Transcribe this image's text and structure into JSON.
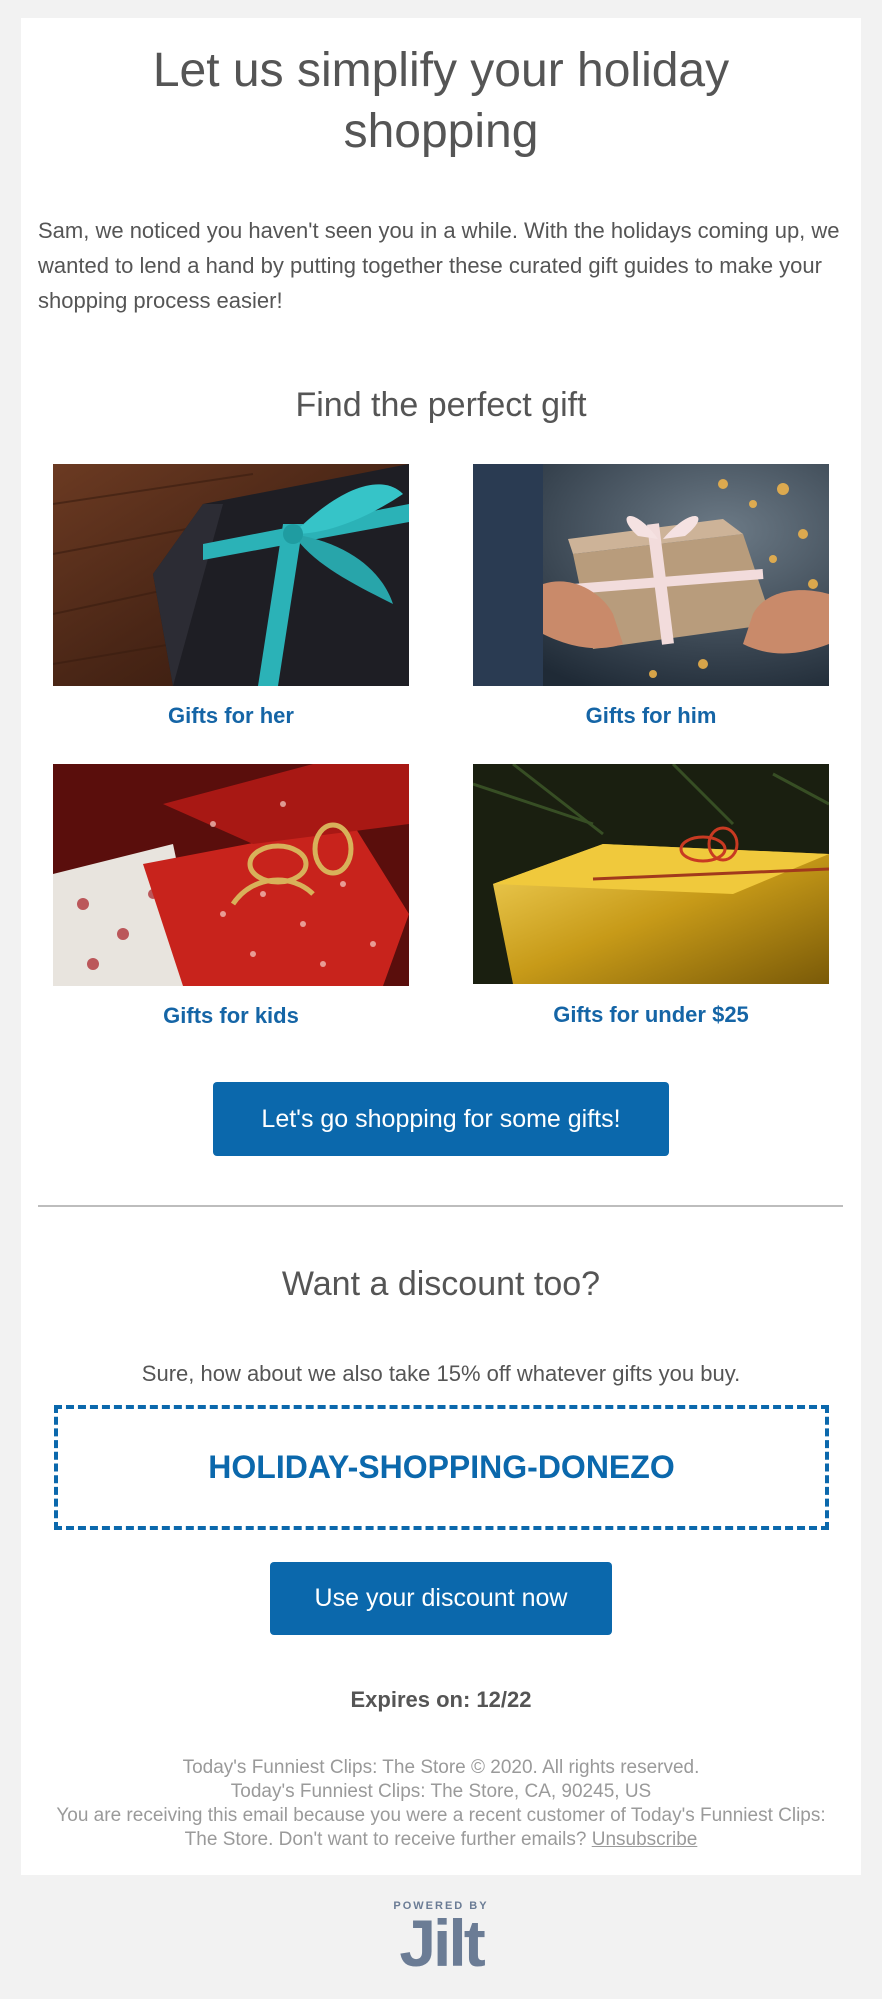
{
  "email": {
    "headline": "Let us simplify your holiday shopping",
    "intro": "Sam, we noticed you haven't seen you in a while. With the holidays coming up, we wanted to lend a hand by putting together these curated gift guides to make your shopping process easier!",
    "gifts_section": {
      "title": "Find the perfect gift",
      "items": [
        {
          "label": "Gifts for her"
        },
        {
          "label": "Gifts for him"
        },
        {
          "label": "Gifts for kids"
        },
        {
          "label": "Gifts for under $25"
        }
      ],
      "cta_label": "Let's go shopping for some gifts!"
    },
    "discount_section": {
      "title": "Want a discount too?",
      "subtitle": "Sure, how about we also take 15% off whatever gifts you buy.",
      "code": "HOLIDAY-SHOPPING-DONEZO",
      "cta_label": "Use your discount now",
      "expires": "Expires on: 12/22"
    },
    "footer": {
      "copyright": "Today's Funniest Clips: The Store © 2020. All rights reserved.",
      "address": "Today's Funniest Clips: The Store, CA, 90245, US",
      "notice": "You are receiving this email because you were a recent customer of Today's Funniest Clips: The Store. Don't want to receive further emails?",
      "unsubscribe_label": "Unsubscribe"
    }
  },
  "branding": {
    "powered_by": "POWERED BY",
    "logo_text": "Jilt"
  },
  "colors": {
    "accent": "#0b68ac",
    "link": "#1565a6",
    "text": "#555555",
    "muted": "#9a9a9a",
    "background": "#f2f2f2",
    "logo": "#6b7c95"
  },
  "images": {
    "gift_1": "black-gift-box-teal-ribbon",
    "gift_2": "hands-holding-kraft-gift-box",
    "gift_3": "red-wrapped-presents",
    "gift_4": "gold-wrapped-gift-under-tree"
  }
}
